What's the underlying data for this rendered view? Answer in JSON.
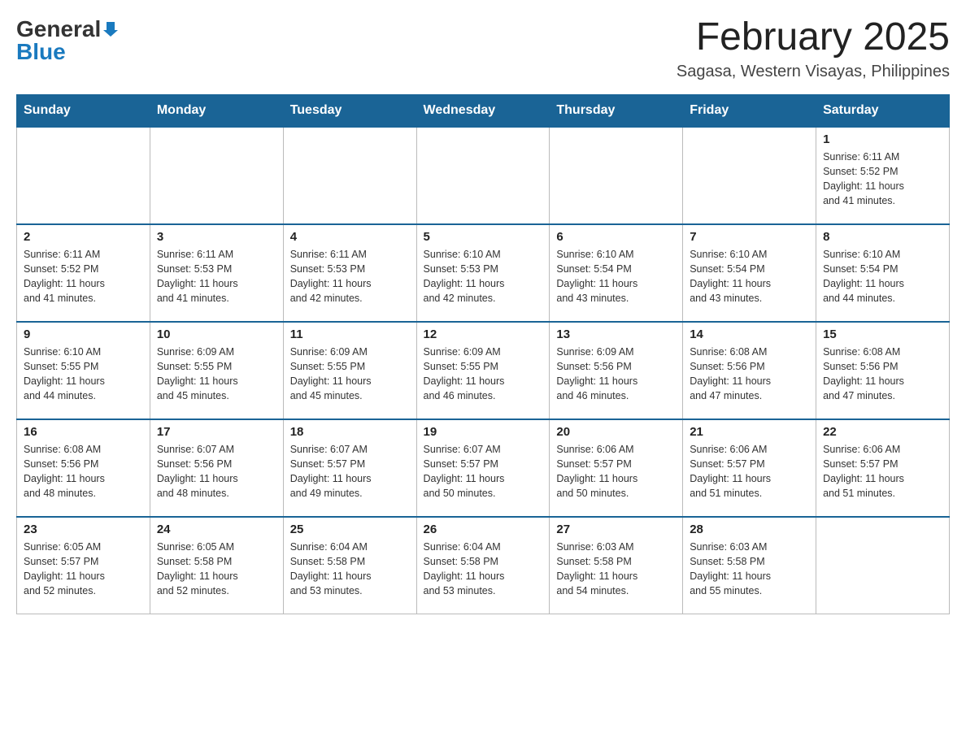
{
  "header": {
    "logo": {
      "general": "General",
      "blue": "Blue",
      "arrow_color": "#1a7abf"
    },
    "title": "February 2025",
    "location": "Sagasa, Western Visayas, Philippines"
  },
  "days_of_week": [
    "Sunday",
    "Monday",
    "Tuesday",
    "Wednesday",
    "Thursday",
    "Friday",
    "Saturday"
  ],
  "weeks": [
    {
      "days": [
        {
          "number": "",
          "info": ""
        },
        {
          "number": "",
          "info": ""
        },
        {
          "number": "",
          "info": ""
        },
        {
          "number": "",
          "info": ""
        },
        {
          "number": "",
          "info": ""
        },
        {
          "number": "",
          "info": ""
        },
        {
          "number": "1",
          "info": "Sunrise: 6:11 AM\nSunset: 5:52 PM\nDaylight: 11 hours\nand 41 minutes."
        }
      ]
    },
    {
      "days": [
        {
          "number": "2",
          "info": "Sunrise: 6:11 AM\nSunset: 5:52 PM\nDaylight: 11 hours\nand 41 minutes."
        },
        {
          "number": "3",
          "info": "Sunrise: 6:11 AM\nSunset: 5:53 PM\nDaylight: 11 hours\nand 41 minutes."
        },
        {
          "number": "4",
          "info": "Sunrise: 6:11 AM\nSunset: 5:53 PM\nDaylight: 11 hours\nand 42 minutes."
        },
        {
          "number": "5",
          "info": "Sunrise: 6:10 AM\nSunset: 5:53 PM\nDaylight: 11 hours\nand 42 minutes."
        },
        {
          "number": "6",
          "info": "Sunrise: 6:10 AM\nSunset: 5:54 PM\nDaylight: 11 hours\nand 43 minutes."
        },
        {
          "number": "7",
          "info": "Sunrise: 6:10 AM\nSunset: 5:54 PM\nDaylight: 11 hours\nand 43 minutes."
        },
        {
          "number": "8",
          "info": "Sunrise: 6:10 AM\nSunset: 5:54 PM\nDaylight: 11 hours\nand 44 minutes."
        }
      ]
    },
    {
      "days": [
        {
          "number": "9",
          "info": "Sunrise: 6:10 AM\nSunset: 5:55 PM\nDaylight: 11 hours\nand 44 minutes."
        },
        {
          "number": "10",
          "info": "Sunrise: 6:09 AM\nSunset: 5:55 PM\nDaylight: 11 hours\nand 45 minutes."
        },
        {
          "number": "11",
          "info": "Sunrise: 6:09 AM\nSunset: 5:55 PM\nDaylight: 11 hours\nand 45 minutes."
        },
        {
          "number": "12",
          "info": "Sunrise: 6:09 AM\nSunset: 5:55 PM\nDaylight: 11 hours\nand 46 minutes."
        },
        {
          "number": "13",
          "info": "Sunrise: 6:09 AM\nSunset: 5:56 PM\nDaylight: 11 hours\nand 46 minutes."
        },
        {
          "number": "14",
          "info": "Sunrise: 6:08 AM\nSunset: 5:56 PM\nDaylight: 11 hours\nand 47 minutes."
        },
        {
          "number": "15",
          "info": "Sunrise: 6:08 AM\nSunset: 5:56 PM\nDaylight: 11 hours\nand 47 minutes."
        }
      ]
    },
    {
      "days": [
        {
          "number": "16",
          "info": "Sunrise: 6:08 AM\nSunset: 5:56 PM\nDaylight: 11 hours\nand 48 minutes."
        },
        {
          "number": "17",
          "info": "Sunrise: 6:07 AM\nSunset: 5:56 PM\nDaylight: 11 hours\nand 48 minutes."
        },
        {
          "number": "18",
          "info": "Sunrise: 6:07 AM\nSunset: 5:57 PM\nDaylight: 11 hours\nand 49 minutes."
        },
        {
          "number": "19",
          "info": "Sunrise: 6:07 AM\nSunset: 5:57 PM\nDaylight: 11 hours\nand 50 minutes."
        },
        {
          "number": "20",
          "info": "Sunrise: 6:06 AM\nSunset: 5:57 PM\nDaylight: 11 hours\nand 50 minutes."
        },
        {
          "number": "21",
          "info": "Sunrise: 6:06 AM\nSunset: 5:57 PM\nDaylight: 11 hours\nand 51 minutes."
        },
        {
          "number": "22",
          "info": "Sunrise: 6:06 AM\nSunset: 5:57 PM\nDaylight: 11 hours\nand 51 minutes."
        }
      ]
    },
    {
      "days": [
        {
          "number": "23",
          "info": "Sunrise: 6:05 AM\nSunset: 5:57 PM\nDaylight: 11 hours\nand 52 minutes."
        },
        {
          "number": "24",
          "info": "Sunrise: 6:05 AM\nSunset: 5:58 PM\nDaylight: 11 hours\nand 52 minutes."
        },
        {
          "number": "25",
          "info": "Sunrise: 6:04 AM\nSunset: 5:58 PM\nDaylight: 11 hours\nand 53 minutes."
        },
        {
          "number": "26",
          "info": "Sunrise: 6:04 AM\nSunset: 5:58 PM\nDaylight: 11 hours\nand 53 minutes."
        },
        {
          "number": "27",
          "info": "Sunrise: 6:03 AM\nSunset: 5:58 PM\nDaylight: 11 hours\nand 54 minutes."
        },
        {
          "number": "28",
          "info": "Sunrise: 6:03 AM\nSunset: 5:58 PM\nDaylight: 11 hours\nand 55 minutes."
        },
        {
          "number": "",
          "info": ""
        }
      ]
    }
  ]
}
